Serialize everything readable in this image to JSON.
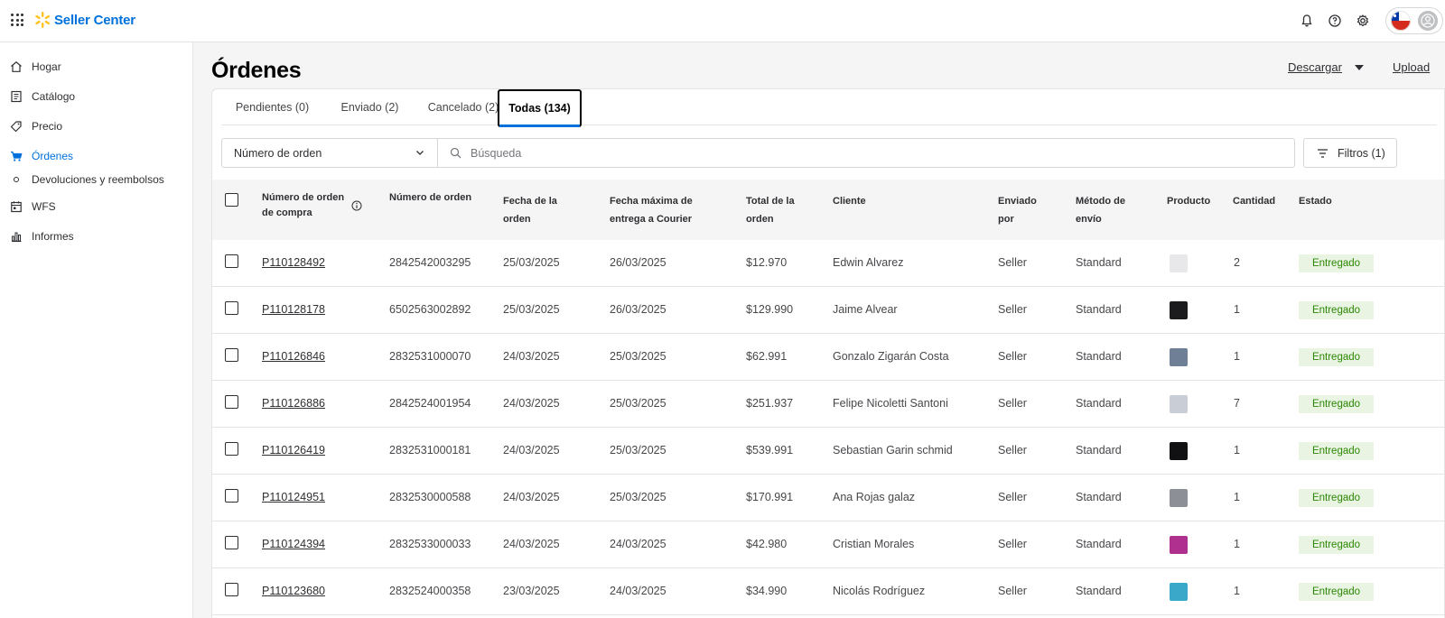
{
  "topbar": {
    "brand": "Seller Center"
  },
  "sidebar": {
    "items": [
      {
        "label": "Hogar",
        "icon": "home-icon"
      },
      {
        "label": "Catálogo",
        "icon": "catalog-icon"
      },
      {
        "label": "Precio",
        "icon": "price-tag-icon"
      },
      {
        "label": "Órdenes",
        "icon": "cart-icon",
        "active": true
      },
      {
        "label": "Devoluciones y reembolsos",
        "icon": "dot-icon"
      },
      {
        "label": "WFS",
        "icon": "calendar-icon"
      },
      {
        "label": "Informes",
        "icon": "bar-chart-icon"
      }
    ]
  },
  "main": {
    "title": "Órdenes",
    "download_label": "Descargar",
    "upload_label": "Upload",
    "tabs": [
      {
        "label": "Pendientes (0)"
      },
      {
        "label": "Enviado (2)"
      },
      {
        "label": "Cancelado (2)"
      },
      {
        "label": "Todas (134)",
        "active": true
      }
    ],
    "search_by_select": "Número de orden",
    "search_placeholder": "Búsqueda",
    "filters_label": "Filtros (1)"
  },
  "table": {
    "headers": {
      "po_number": "Número de orden de compra",
      "order_number": "Número de orden",
      "order_date": "Fecha de la orden",
      "courier_date": "Fecha máxima de entrega a Courier",
      "total": "Total de la orden",
      "customer": "Cliente",
      "shipped_by": "Enviado por",
      "ship_method": "Método de envío",
      "product": "Producto",
      "quantity": "Cantidad",
      "status": "Estado"
    },
    "rows": [
      {
        "po": "P110128492",
        "order": "2842542003295",
        "date": "25/03/2025",
        "courier": "26/03/2025",
        "total": "$12.970",
        "customer": "Edwin Alvarez",
        "shipped_by": "Seller",
        "method": "Standard",
        "product_color": "#e8e8ea",
        "qty": "2",
        "status": "Entregado"
      },
      {
        "po": "P110128178",
        "order": "6502563002892",
        "date": "25/03/2025",
        "courier": "26/03/2025",
        "total": "$129.990",
        "customer": "Jaime Alvear",
        "shipped_by": "Seller",
        "method": "Standard",
        "product_color": "#1c1c1e",
        "qty": "1",
        "status": "Entregado"
      },
      {
        "po": "P110126846",
        "order": "2832531000070",
        "date": "24/03/2025",
        "courier": "25/03/2025",
        "total": "$62.991",
        "customer": "Gonzalo Zigarán Costa",
        "shipped_by": "Seller",
        "method": "Standard",
        "product_color": "#6f7f96",
        "qty": "1",
        "status": "Entregado"
      },
      {
        "po": "P110126886",
        "order": "2842524001954",
        "date": "24/03/2025",
        "courier": "25/03/2025",
        "total": "$251.937",
        "customer": "Felipe Nicoletti Santoni",
        "shipped_by": "Seller",
        "method": "Standard",
        "product_color": "#c9ced6",
        "qty": "7",
        "status": "Entregado"
      },
      {
        "po": "P110126419",
        "order": "2832531000181",
        "date": "24/03/2025",
        "courier": "25/03/2025",
        "total": "$539.991",
        "customer": "Sebastian Garin schmid",
        "shipped_by": "Seller",
        "method": "Standard",
        "product_color": "#111113",
        "qty": "1",
        "status": "Entregado"
      },
      {
        "po": "P110124951",
        "order": "2832530000588",
        "date": "24/03/2025",
        "courier": "25/03/2025",
        "total": "$170.991",
        "customer": "Ana Rojas galaz",
        "shipped_by": "Seller",
        "method": "Standard",
        "product_color": "#8c8f95",
        "qty": "1",
        "status": "Entregado"
      },
      {
        "po": "P110124394",
        "order": "2832533000033",
        "date": "24/03/2025",
        "courier": "24/03/2025",
        "total": "$42.980",
        "customer": "Cristian Morales",
        "shipped_by": "Seller",
        "method": "Standard",
        "product_color": "#b0308f",
        "qty": "1",
        "status": "Entregado"
      },
      {
        "po": "P110123680",
        "order": "2832524000358",
        "date": "23/03/2025",
        "courier": "24/03/2025",
        "total": "$34.990",
        "customer": "Nicolás Rodríguez",
        "shipped_by": "Seller",
        "method": "Standard",
        "product_color": "#3aa9c9",
        "qty": "1",
        "status": "Entregado"
      }
    ]
  },
  "colors": {
    "brand_blue": "#0071dc",
    "spark_yellow": "#ffc220",
    "status_green": "#2a8703",
    "status_bg": "#eaf4e3"
  }
}
